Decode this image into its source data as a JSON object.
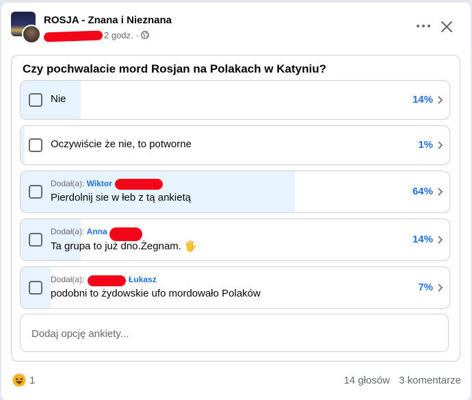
{
  "post": {
    "group_name": "ROSJA - Znana i Nieznana",
    "time": "2 godz. ·",
    "more_icon": "more-horizontal-icon",
    "close_icon": "close-icon",
    "privacy_icon": "globe-icon"
  },
  "poll": {
    "question": "Czy pochwalacie mord Rosjan na Polakach w Katyniu?",
    "options": [
      {
        "label": "Nie",
        "percent_text": "14%",
        "percent": 14
      },
      {
        "label": "Oczywiście że nie, to potworne",
        "percent_text": "1%",
        "percent": 1
      },
      {
        "added_by_prefix": "Dodał(a):",
        "added_by_name": "Wiktor",
        "label": "Pierdolnij sie w łeb z tą ankietą",
        "percent_text": "64%",
        "percent": 64
      },
      {
        "added_by_prefix": "Dodał(a):",
        "added_by_name": "Anna",
        "label": "Ta grupa to już dno.Żegnam.",
        "emoji": "🖐",
        "percent_text": "14%",
        "percent": 14
      },
      {
        "added_by_prefix": "Dodał(a):",
        "added_by_name": "Łukasz",
        "label": "podobni to żydowskie ufo mordowało Polaków",
        "percent_text": "7%",
        "percent": 7
      }
    ],
    "add_option_placeholder": "Dodaj opcję ankiety..."
  },
  "footer": {
    "reaction_icon": "haha-emoji-icon",
    "reaction_count": "1",
    "votes": "14 głosów",
    "comments": "3 komentarze"
  },
  "colors": {
    "fill": "#e7f3ff",
    "accent": "#216fdb",
    "redaction": "#f2061a"
  }
}
